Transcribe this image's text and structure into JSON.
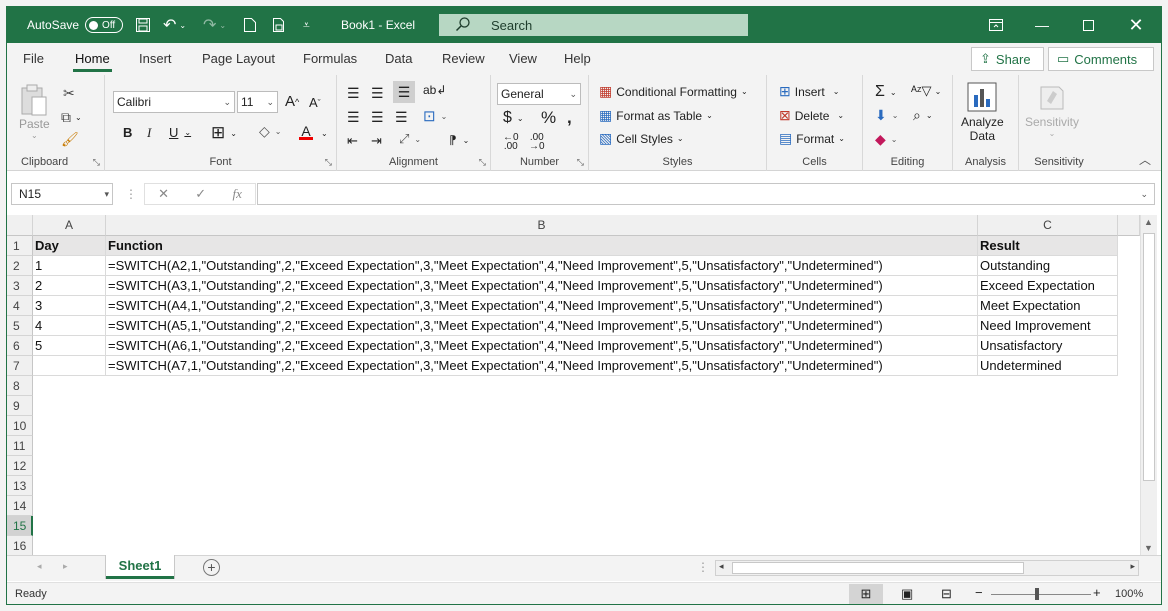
{
  "titlebar": {
    "autosave_label": "AutoSave",
    "autosave_state": "Off",
    "title": "Book1  -  Excel",
    "search_placeholder": "Search"
  },
  "tabs": [
    "File",
    "Home",
    "Insert",
    "Page Layout",
    "Formulas",
    "Data",
    "Review",
    "View",
    "Help"
  ],
  "active_tab": "Home",
  "share_label": "Share",
  "comments_label": "Comments",
  "ribbon": {
    "clipboard": {
      "paste": "Paste",
      "label": "Clipboard"
    },
    "font": {
      "name": "Calibri",
      "size": "11",
      "label": "Font"
    },
    "alignment": {
      "label": "Alignment"
    },
    "number": {
      "format": "General",
      "label": "Number"
    },
    "styles": {
      "conditional": "Conditional Formatting",
      "table": "Format as Table",
      "cell": "Cell Styles",
      "label": "Styles"
    },
    "cells": {
      "insert": "Insert",
      "delete": "Delete",
      "format": "Format",
      "label": "Cells"
    },
    "editing": {
      "label": "Editing"
    },
    "analysis": {
      "analyze_line1": "Analyze",
      "analyze_line2": "Data",
      "label": "Analysis"
    },
    "sensitivity": {
      "button": "Sensitivity",
      "label": "Sensitivity"
    }
  },
  "formula_bar": {
    "name_box": "N15",
    "fx": "fx",
    "content": ""
  },
  "columns": [
    "A",
    "B",
    "C"
  ],
  "rows": [
    [
      "Day",
      "Function",
      "Result"
    ],
    [
      "1",
      "=SWITCH(A2,1,\"Outstanding\",2,\"Exceed Expectation\",3,\"Meet Expectation\",4,\"Need Improvement\",5,\"Unsatisfactory\",\"Undetermined\")",
      "Outstanding"
    ],
    [
      "2",
      "=SWITCH(A3,1,\"Outstanding\",2,\"Exceed Expectation\",3,\"Meet Expectation\",4,\"Need Improvement\",5,\"Unsatisfactory\",\"Undetermined\")",
      "Exceed Expectation"
    ],
    [
      "3",
      "=SWITCH(A4,1,\"Outstanding\",2,\"Exceed Expectation\",3,\"Meet Expectation\",4,\"Need Improvement\",5,\"Unsatisfactory\",\"Undetermined\")",
      "Meet Expectation"
    ],
    [
      "4",
      "=SWITCH(A5,1,\"Outstanding\",2,\"Exceed Expectation\",3,\"Meet Expectation\",4,\"Need Improvement\",5,\"Unsatisfactory\",\"Undetermined\")",
      "Need Improvement"
    ],
    [
      "5",
      "=SWITCH(A6,1,\"Outstanding\",2,\"Exceed Expectation\",3,\"Meet Expectation\",4,\"Need Improvement\",5,\"Unsatisfactory\",\"Undetermined\")",
      "Unsatisfactory"
    ],
    [
      "",
      "=SWITCH(A7,1,\"Outstanding\",2,\"Exceed Expectation\",3,\"Meet Expectation\",4,\"Need Improvement\",5,\"Unsatisfactory\",\"Undetermined\")",
      "Undetermined"
    ]
  ],
  "row_numbers": [
    "1",
    "2",
    "3",
    "4",
    "5",
    "6",
    "7",
    "8",
    "9",
    "10",
    "11",
    "12",
    "13",
    "14",
    "15",
    "16"
  ],
  "selected_row": "15",
  "sheet_tab": "Sheet1",
  "status": {
    "ready": "Ready",
    "zoom": "100%"
  },
  "colors": {
    "brand": "#217346",
    "header_fill": "#e7e6e6"
  }
}
